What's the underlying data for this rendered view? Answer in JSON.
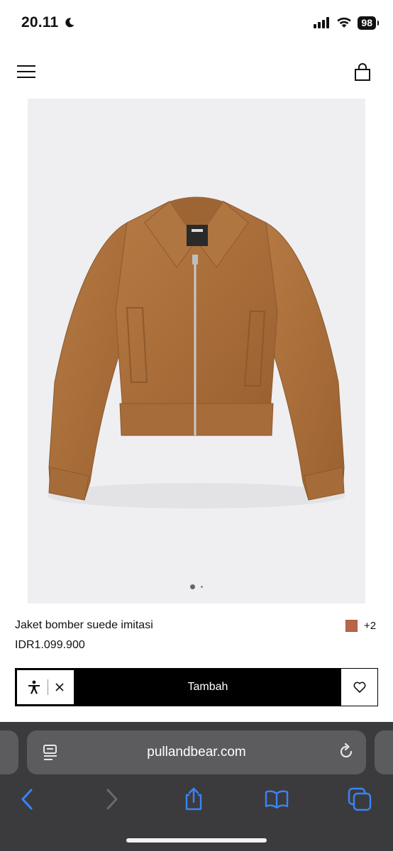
{
  "status_bar": {
    "time": "20.11",
    "battery": "98"
  },
  "header": {
    "menu_icon": "hamburger-menu-icon",
    "bag_icon": "shopping-bag-icon"
  },
  "product": {
    "name": "Jaket bomber suede imitasi",
    "price": "IDR1.099.900",
    "swatch_color": "#b8654a",
    "more_colors": "+2",
    "image_pages": 2,
    "current_image": 1
  },
  "actions": {
    "add_label": "Tambah",
    "accessibility_icon": "accessibility-person-icon",
    "close_icon": "close-icon",
    "favorite_icon": "heart-icon"
  },
  "browser": {
    "url": "pullandbear.com",
    "accent": "#3a84f5"
  }
}
